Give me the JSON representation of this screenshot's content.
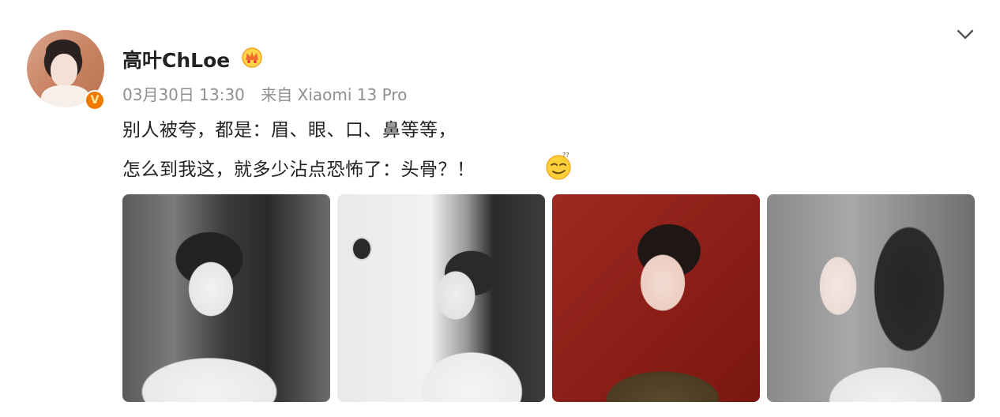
{
  "post": {
    "author": {
      "name": "高叶ChLoe",
      "verified_badge": "V",
      "badge_icon": "crown-icon"
    },
    "meta": {
      "timestamp": "03月30日 13:30",
      "source": "来自 Xiaomi 13 Pro"
    },
    "text": {
      "line1": "别人被夸，都是：眉、眼、口、鼻等等，",
      "line2": "怎么到我这，就多少沾点恐怖了：头骨？！"
    },
    "emoji": "thinking-face-emoji",
    "menu_icon": "chevron-down-icon",
    "images": [
      {
        "id": "photo-1",
        "alt": ""
      },
      {
        "id": "photo-2",
        "alt": ""
      },
      {
        "id": "photo-3",
        "alt": ""
      },
      {
        "id": "photo-4",
        "alt": ""
      }
    ]
  },
  "colors": {
    "meta_text": "#8f8f8f",
    "verified_badge": "#f07a00",
    "body_text": "#222222"
  }
}
